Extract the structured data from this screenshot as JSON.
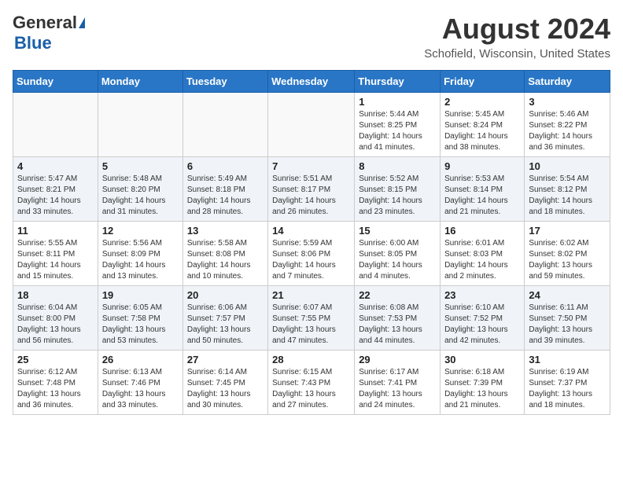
{
  "header": {
    "logo_line1": "General",
    "logo_line2": "Blue",
    "month_year": "August 2024",
    "location": "Schofield, Wisconsin, United States"
  },
  "days_of_week": [
    "Sunday",
    "Monday",
    "Tuesday",
    "Wednesday",
    "Thursday",
    "Friday",
    "Saturday"
  ],
  "weeks": [
    [
      {
        "day": "",
        "info": ""
      },
      {
        "day": "",
        "info": ""
      },
      {
        "day": "",
        "info": ""
      },
      {
        "day": "",
        "info": ""
      },
      {
        "day": "1",
        "info": "Sunrise: 5:44 AM\nSunset: 8:25 PM\nDaylight: 14 hours\nand 41 minutes."
      },
      {
        "day": "2",
        "info": "Sunrise: 5:45 AM\nSunset: 8:24 PM\nDaylight: 14 hours\nand 38 minutes."
      },
      {
        "day": "3",
        "info": "Sunrise: 5:46 AM\nSunset: 8:22 PM\nDaylight: 14 hours\nand 36 minutes."
      }
    ],
    [
      {
        "day": "4",
        "info": "Sunrise: 5:47 AM\nSunset: 8:21 PM\nDaylight: 14 hours\nand 33 minutes."
      },
      {
        "day": "5",
        "info": "Sunrise: 5:48 AM\nSunset: 8:20 PM\nDaylight: 14 hours\nand 31 minutes."
      },
      {
        "day": "6",
        "info": "Sunrise: 5:49 AM\nSunset: 8:18 PM\nDaylight: 14 hours\nand 28 minutes."
      },
      {
        "day": "7",
        "info": "Sunrise: 5:51 AM\nSunset: 8:17 PM\nDaylight: 14 hours\nand 26 minutes."
      },
      {
        "day": "8",
        "info": "Sunrise: 5:52 AM\nSunset: 8:15 PM\nDaylight: 14 hours\nand 23 minutes."
      },
      {
        "day": "9",
        "info": "Sunrise: 5:53 AM\nSunset: 8:14 PM\nDaylight: 14 hours\nand 21 minutes."
      },
      {
        "day": "10",
        "info": "Sunrise: 5:54 AM\nSunset: 8:12 PM\nDaylight: 14 hours\nand 18 minutes."
      }
    ],
    [
      {
        "day": "11",
        "info": "Sunrise: 5:55 AM\nSunset: 8:11 PM\nDaylight: 14 hours\nand 15 minutes."
      },
      {
        "day": "12",
        "info": "Sunrise: 5:56 AM\nSunset: 8:09 PM\nDaylight: 14 hours\nand 13 minutes."
      },
      {
        "day": "13",
        "info": "Sunrise: 5:58 AM\nSunset: 8:08 PM\nDaylight: 14 hours\nand 10 minutes."
      },
      {
        "day": "14",
        "info": "Sunrise: 5:59 AM\nSunset: 8:06 PM\nDaylight: 14 hours\nand 7 minutes."
      },
      {
        "day": "15",
        "info": "Sunrise: 6:00 AM\nSunset: 8:05 PM\nDaylight: 14 hours\nand 4 minutes."
      },
      {
        "day": "16",
        "info": "Sunrise: 6:01 AM\nSunset: 8:03 PM\nDaylight: 14 hours\nand 2 minutes."
      },
      {
        "day": "17",
        "info": "Sunrise: 6:02 AM\nSunset: 8:02 PM\nDaylight: 13 hours\nand 59 minutes."
      }
    ],
    [
      {
        "day": "18",
        "info": "Sunrise: 6:04 AM\nSunset: 8:00 PM\nDaylight: 13 hours\nand 56 minutes."
      },
      {
        "day": "19",
        "info": "Sunrise: 6:05 AM\nSunset: 7:58 PM\nDaylight: 13 hours\nand 53 minutes."
      },
      {
        "day": "20",
        "info": "Sunrise: 6:06 AM\nSunset: 7:57 PM\nDaylight: 13 hours\nand 50 minutes."
      },
      {
        "day": "21",
        "info": "Sunrise: 6:07 AM\nSunset: 7:55 PM\nDaylight: 13 hours\nand 47 minutes."
      },
      {
        "day": "22",
        "info": "Sunrise: 6:08 AM\nSunset: 7:53 PM\nDaylight: 13 hours\nand 44 minutes."
      },
      {
        "day": "23",
        "info": "Sunrise: 6:10 AM\nSunset: 7:52 PM\nDaylight: 13 hours\nand 42 minutes."
      },
      {
        "day": "24",
        "info": "Sunrise: 6:11 AM\nSunset: 7:50 PM\nDaylight: 13 hours\nand 39 minutes."
      }
    ],
    [
      {
        "day": "25",
        "info": "Sunrise: 6:12 AM\nSunset: 7:48 PM\nDaylight: 13 hours\nand 36 minutes."
      },
      {
        "day": "26",
        "info": "Sunrise: 6:13 AM\nSunset: 7:46 PM\nDaylight: 13 hours\nand 33 minutes."
      },
      {
        "day": "27",
        "info": "Sunrise: 6:14 AM\nSunset: 7:45 PM\nDaylight: 13 hours\nand 30 minutes."
      },
      {
        "day": "28",
        "info": "Sunrise: 6:15 AM\nSunset: 7:43 PM\nDaylight: 13 hours\nand 27 minutes."
      },
      {
        "day": "29",
        "info": "Sunrise: 6:17 AM\nSunset: 7:41 PM\nDaylight: 13 hours\nand 24 minutes."
      },
      {
        "day": "30",
        "info": "Sunrise: 6:18 AM\nSunset: 7:39 PM\nDaylight: 13 hours\nand 21 minutes."
      },
      {
        "day": "31",
        "info": "Sunrise: 6:19 AM\nSunset: 7:37 PM\nDaylight: 13 hours\nand 18 minutes."
      }
    ]
  ]
}
